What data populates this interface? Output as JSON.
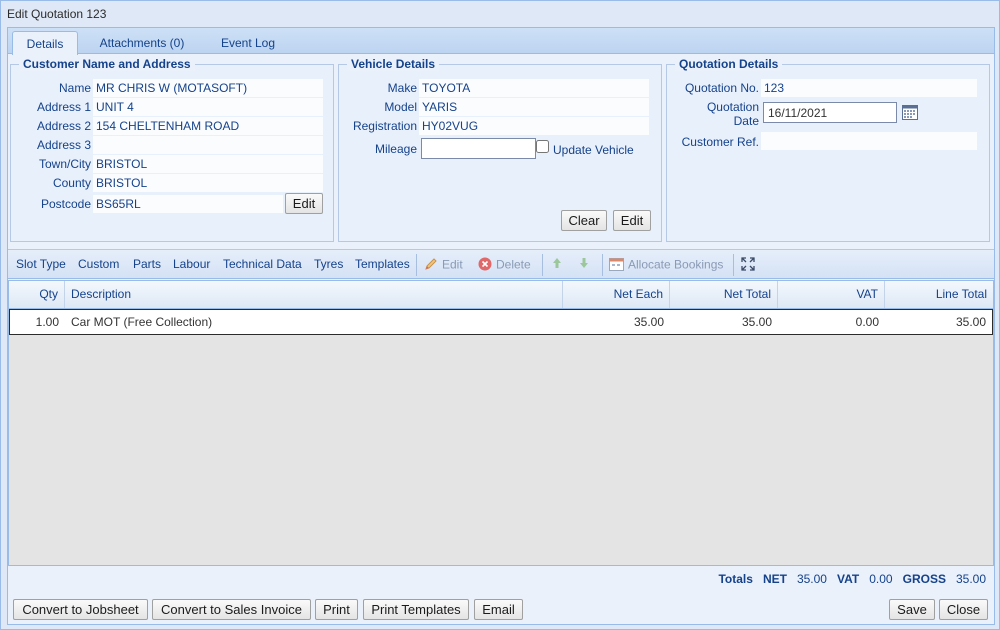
{
  "window": {
    "title": "Edit Quotation 123"
  },
  "tabs": [
    {
      "label": "Details"
    },
    {
      "label": "Attachments (0)"
    },
    {
      "label": "Event Log"
    }
  ],
  "customer": {
    "title": "Customer Name and Address",
    "labels": {
      "name": "Name",
      "address1": "Address 1",
      "address2": "Address 2",
      "address3": "Address 3",
      "town": "Town/City",
      "county": "County",
      "postcode": "Postcode"
    },
    "values": {
      "name": "MR CHRIS W (MOTASOFT)",
      "address1": "UNIT 4",
      "address2": "154 CHELTENHAM ROAD",
      "address3": "",
      "town": "BRISTOL",
      "county": "BRISTOL",
      "postcode": "BS65RL"
    },
    "edit_label": "Edit"
  },
  "vehicle": {
    "title": "Vehicle Details",
    "labels": {
      "make": "Make",
      "model": "Model",
      "registration": "Registration",
      "mileage": "Mileage",
      "update": "Update Vehicle"
    },
    "values": {
      "make": "TOYOTA",
      "model": "YARIS",
      "registration": "HY02VUG",
      "mileage": ""
    },
    "update_checked": false,
    "clear_label": "Clear",
    "edit_label": "Edit"
  },
  "quotation": {
    "title": "Quotation Details",
    "labels": {
      "number": "Quotation No.",
      "date_line1": "Quotation",
      "date_line2": "Date",
      "customer_ref": "Customer Ref."
    },
    "values": {
      "number": "123",
      "date": "16/11/2021",
      "customer_ref": ""
    }
  },
  "toolbar": {
    "slot_type": "Slot Type",
    "custom": "Custom",
    "parts": "Parts",
    "labour": "Labour",
    "technical_data": "Technical Data",
    "tyres": "Tyres",
    "templates": "Templates",
    "edit": "Edit",
    "delete": "Delete",
    "allocate": "Allocate Bookings"
  },
  "grid": {
    "columns": [
      "Qty",
      "Description",
      "Net Each",
      "Net Total",
      "VAT",
      "Line Total"
    ],
    "rows": [
      {
        "qty": "1.00",
        "description": "Car MOT (Free Collection)",
        "net_each": "35.00",
        "net_total": "35.00",
        "vat": "0.00",
        "line_total": "35.00"
      }
    ]
  },
  "totals": {
    "label": "Totals",
    "net_label": "NET",
    "net": "35.00",
    "vat_label": "VAT",
    "vat": "0.00",
    "gross_label": "GROSS",
    "gross": "35.00"
  },
  "footer": {
    "convert_jobsheet": "Convert to Jobsheet",
    "convert_invoice": "Convert to Sales Invoice",
    "print": "Print",
    "print_templates": "Print Templates",
    "email": "Email",
    "save": "Save",
    "close": "Close"
  },
  "colors": {
    "accent": "#15428b",
    "panel_bg": "#dfe8f6",
    "border": "#99bbe8"
  },
  "icons": [
    "pencil-icon",
    "delete-circle-icon",
    "arrow-up-icon",
    "arrow-down-icon",
    "calendar-booking-icon",
    "expand-icon",
    "calendar-icon"
  ]
}
